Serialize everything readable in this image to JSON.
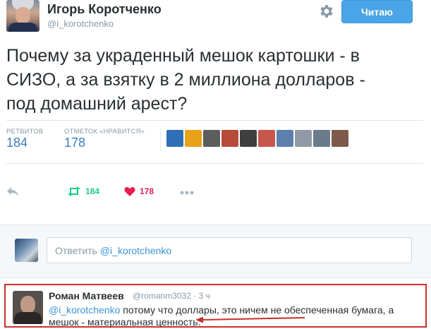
{
  "author": {
    "name": "Игорь Коротченко",
    "handle": "@i_korotchenko"
  },
  "follow_button": {
    "label": "Читаю"
  },
  "tweet": {
    "text_line1": "Почему за украденный мешок картошки - в",
    "text_line2": "СИЗО, а за взятку в 2 миллиона долларов -",
    "text_line3": "под домашний арест?"
  },
  "stats": {
    "retweets_label": "РЕТВИТОВ",
    "retweets_value": "184",
    "likes_label": "ОТМЕТОК «НРАВИТСЯ»",
    "likes_value": "178"
  },
  "likers": {
    "count": 10,
    "colors": [
      "#2f6fb6",
      "#e8a21a",
      "#5d5d5d",
      "#b84a3a",
      "#3f3f3f",
      "#c7564d",
      "#5c7fae",
      "#8f9aa4",
      "#6a7c8c",
      "#7d5a4a"
    ]
  },
  "actions": {
    "retweet_count": "184",
    "like_count": "178"
  },
  "reply_box": {
    "placeholder": "Ответить",
    "mention": "@i_korotchenko"
  },
  "reply": {
    "name": "Роман Матвеев",
    "meta": "@romanm3032 · 3 ч",
    "mention": "@i_korotchenko",
    "line1_rest": " потому что доллары, это ничем не обеспеченная бумага, а",
    "line2": "мешок -  материальная ценность."
  },
  "colors": {
    "accent": "#4aa4e6",
    "link": "#3b94d9",
    "retweet_green": "#19cf86",
    "like_red": "#e81c4f",
    "highlight_border": "#c9302c"
  }
}
